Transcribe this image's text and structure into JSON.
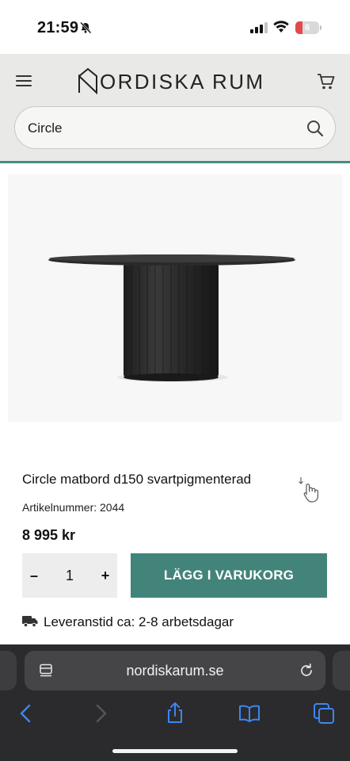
{
  "status_bar": {
    "time": "21:59",
    "battery": "6"
  },
  "header": {
    "logo_letter": "N",
    "logo_rest": "ORDISKA RUM",
    "accent": "#4a8a80"
  },
  "search": {
    "value": "Circle"
  },
  "product": {
    "title": "Circle matbord d150 svartpigmenterad",
    "article_number": "Artikelnummer: 2044",
    "price": "8 995 kr",
    "quantity": {
      "minus": "–",
      "value": "1",
      "plus": "+"
    },
    "add_to_cart_label": "LÄGG I VARUKORG",
    "delivery": "Leveranstid ca: 2-8 arbetsdagar",
    "button_color": "#43847a"
  },
  "browser": {
    "url": "nordiskarum.se"
  },
  "icons": [
    "silent-bell-icon",
    "signal-icon",
    "wifi-icon",
    "battery-icon",
    "menu-icon",
    "cart-icon",
    "search-icon",
    "hand-cursor-icon",
    "truck-icon",
    "page-icon",
    "reload-icon",
    "back-icon",
    "forward-icon",
    "share-icon",
    "bookmarks-icon",
    "tabs-icon"
  ]
}
